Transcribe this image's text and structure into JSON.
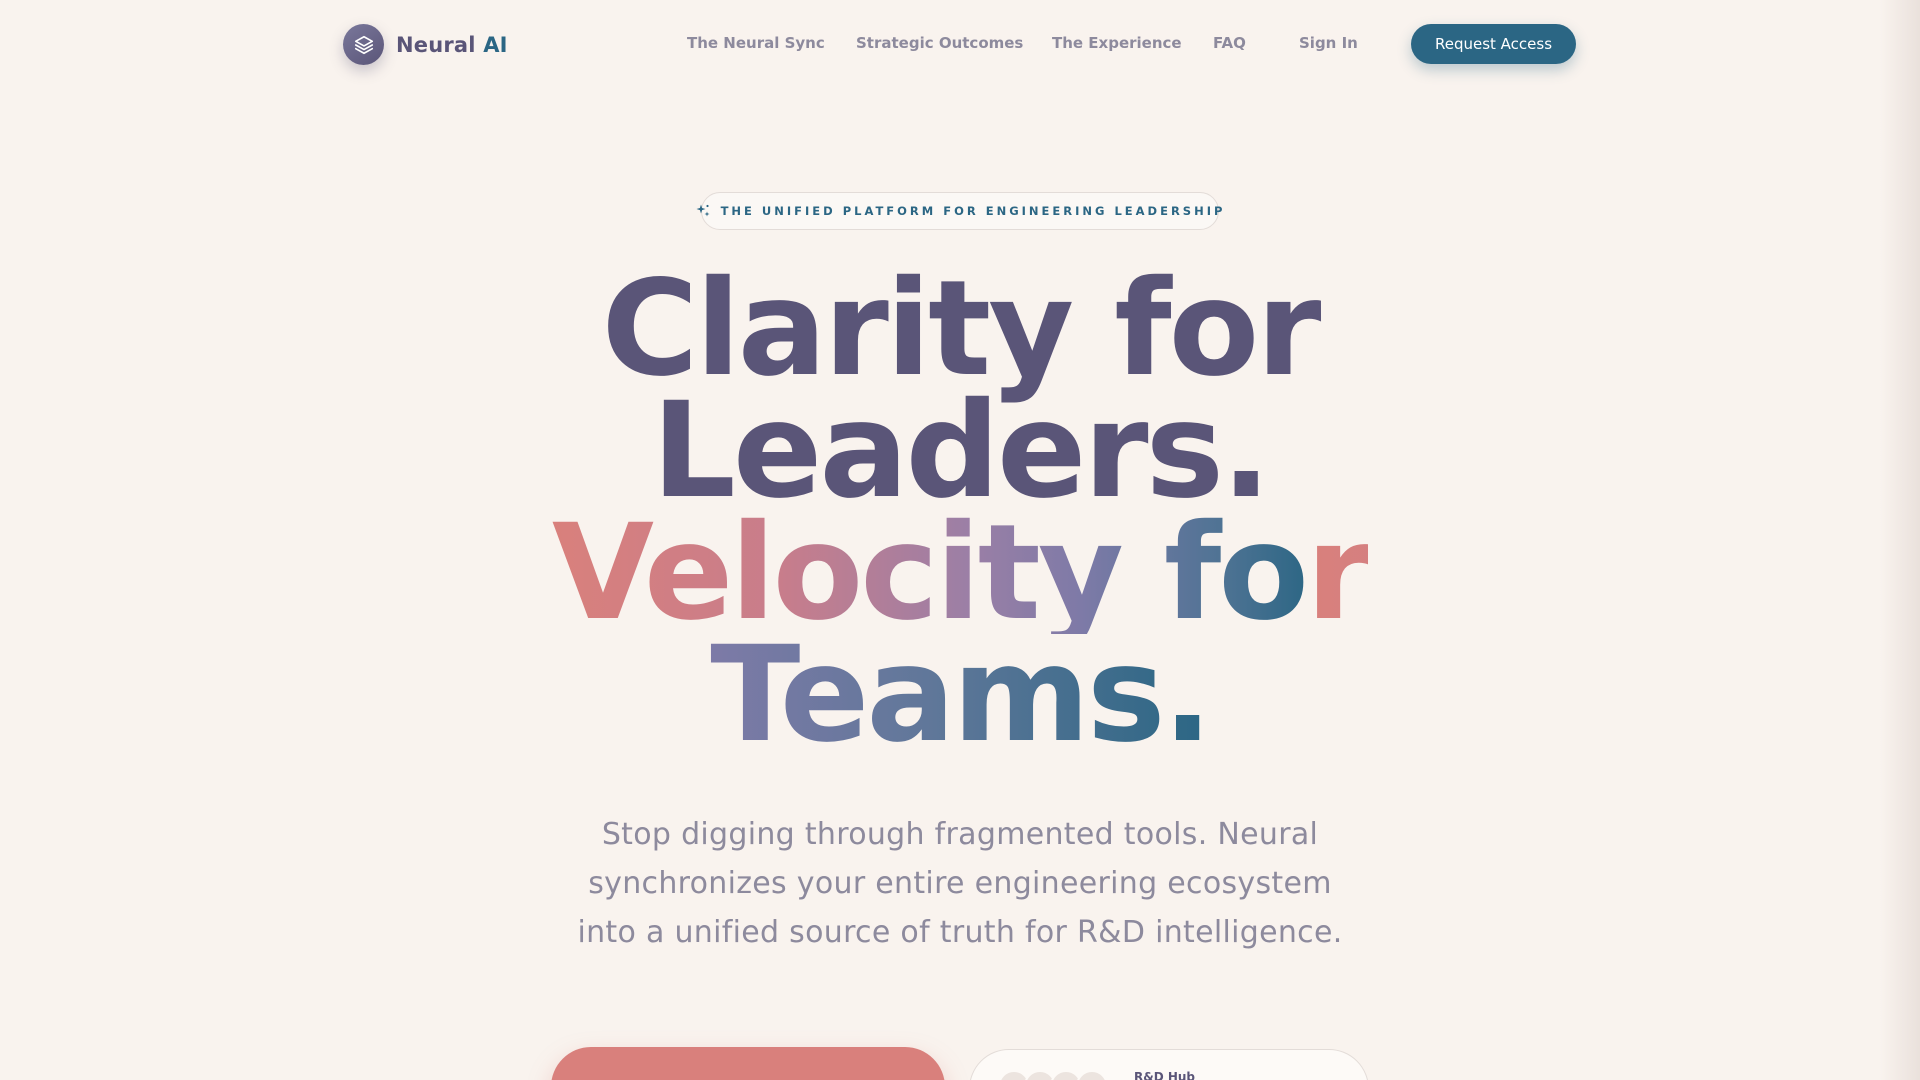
{
  "brand": {
    "name": "Neural",
    "accent": "AI"
  },
  "nav": {
    "links": [
      "The Neural Sync",
      "Strategic Outcomes",
      "The Experience",
      "FAQ"
    ],
    "sign_in": "Sign In",
    "request_access": "Request Access"
  },
  "hero": {
    "eyebrow": "THE UNIFIED PLATFORM FOR ENGINEERING LEADERSHIP",
    "headline_line1": "Clarity for",
    "headline_line2": "Leaders.",
    "headline_line3": "Velocity for",
    "headline_line4": "Teams.",
    "subtext": "Stop digging through fragmented tools. Neural synchronizes your entire engineering ecosystem into a unified source of truth for R&D intelligence."
  },
  "cta": {
    "hub_label": "R&D Hub"
  },
  "icons": {
    "brand": "layers-icon",
    "eyebrow": "sparkles-icon"
  },
  "colors": {
    "background": "#f9f3ee",
    "primary_dark": "#5a5578",
    "teal": "#2b6684",
    "coral": "#d9807c",
    "muted_text": "#8d8a9d"
  }
}
